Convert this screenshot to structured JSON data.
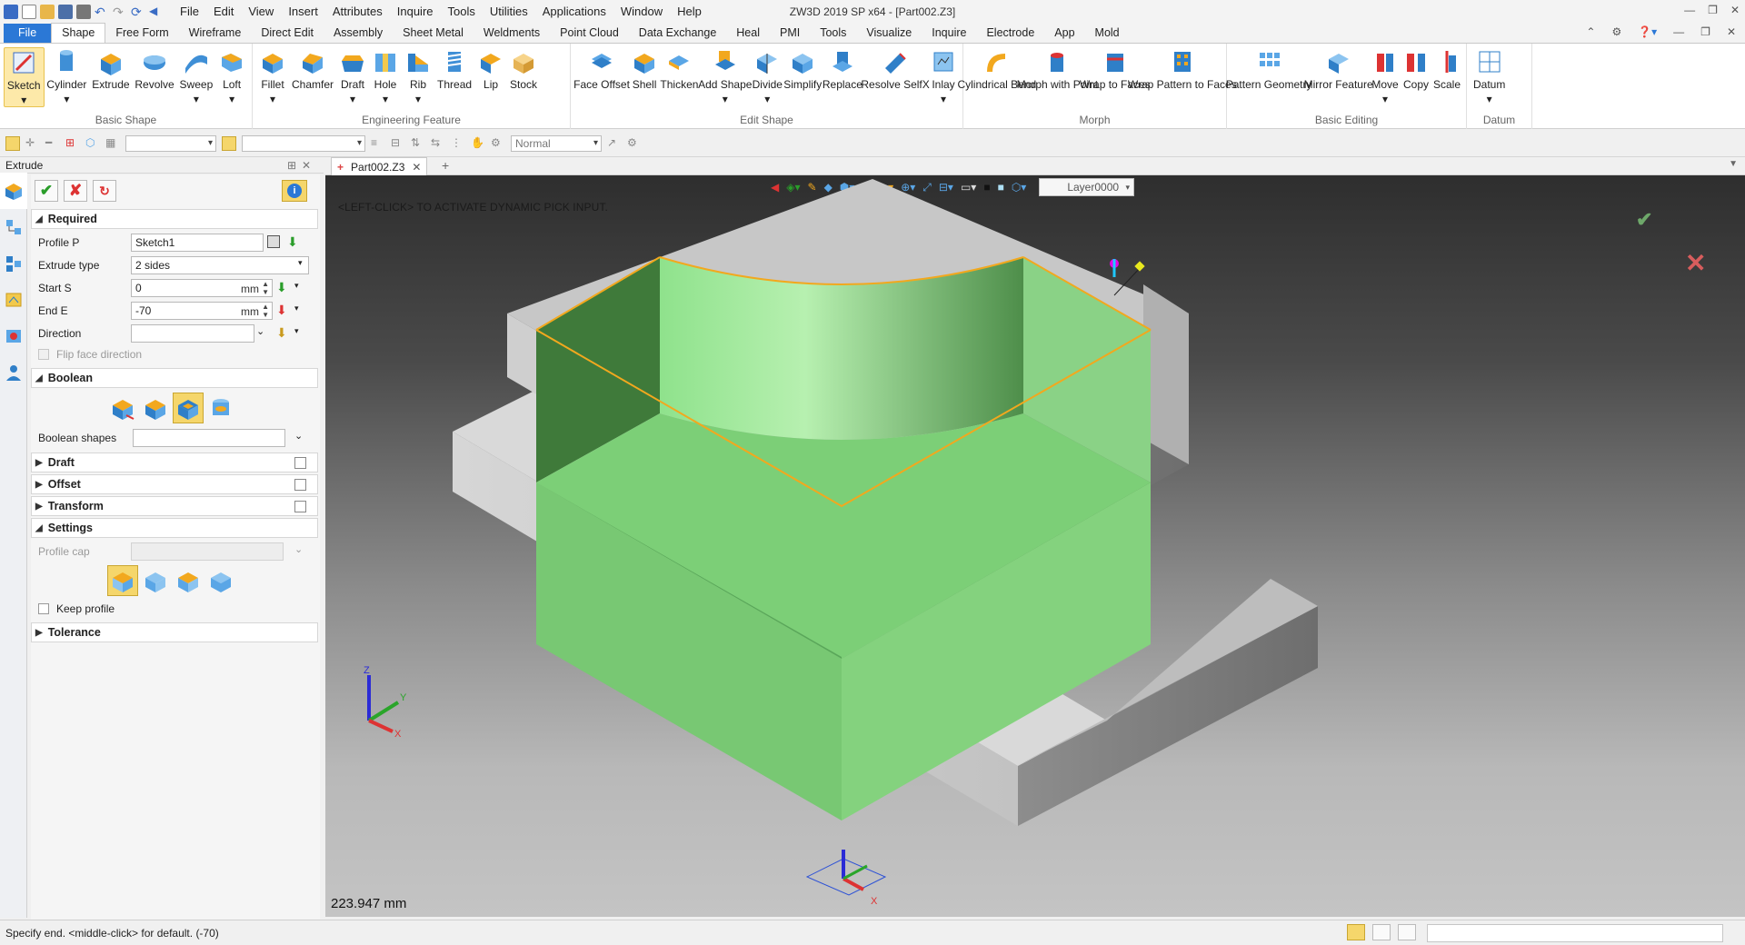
{
  "app": {
    "title": "ZW3D 2019 SP x64 - [Part002.Z3]"
  },
  "menu": [
    "File",
    "Edit",
    "View",
    "Insert",
    "Attributes",
    "Inquire",
    "Tools",
    "Utilities",
    "Applications",
    "Window",
    "Help"
  ],
  "ribbon_tabs": [
    "File",
    "Shape",
    "Free Form",
    "Wireframe",
    "Direct Edit",
    "Assembly",
    "Sheet Metal",
    "Weldments",
    "Point Cloud",
    "Data Exchange",
    "Heal",
    "PMI",
    "Tools",
    "Visualize",
    "Inquire",
    "Electrode",
    "App",
    "Mold"
  ],
  "ribbon": {
    "basic_shape": {
      "name": "Basic Shape",
      "items": [
        "Sketch",
        "Cylinder",
        "Extrude",
        "Revolve",
        "Sweep",
        "Loft"
      ]
    },
    "engineering_feature": {
      "name": "Engineering Feature",
      "items": [
        "Fillet",
        "Chamfer",
        "Draft",
        "Hole",
        "Rib",
        "Thread",
        "Lip",
        "Stock"
      ]
    },
    "edit_shape": {
      "name": "Edit Shape",
      "items": [
        "Face Offset",
        "Shell",
        "Thicken",
        "Add Shape",
        "Divide",
        "Simplify",
        "Replace",
        "Resolve SelfX",
        "Inlay"
      ]
    },
    "morph": {
      "name": "Morph",
      "items": [
        "Cylindrical Bend",
        "Morph with Point",
        "Wrap to Faces",
        "Wrap Pattern to Faces"
      ]
    },
    "basic_editing": {
      "name": "Basic Editing",
      "items": [
        "Pattern Geometry",
        "Mirror Feature",
        "Move",
        "Copy",
        "Scale"
      ]
    },
    "datum": {
      "name": "Datum",
      "items": [
        "Datum"
      ]
    }
  },
  "toolbar2": {
    "render_mode": "Normal"
  },
  "panel": {
    "title": "Extrude",
    "required_label": "Required",
    "profile_label": "Profile P",
    "profile_value": "Sketch1",
    "extrude_type_label": "Extrude type",
    "extrude_type_value": "2 sides",
    "start_label": "Start S",
    "start_value": "0",
    "end_label": "End E",
    "end_value": "-70",
    "unit": "mm",
    "direction_label": "Direction",
    "direction_value": "",
    "flip_label": "Flip face direction",
    "boolean_label": "Boolean",
    "boolean_shapes_label": "Boolean shapes",
    "draft_label": "Draft",
    "offset_label": "Offset",
    "transform_label": "Transform",
    "settings_label": "Settings",
    "profile_cap_label": "Profile cap",
    "keep_profile_label": "Keep profile",
    "tolerance_label": "Tolerance"
  },
  "document": {
    "tab": "Part002.Z3"
  },
  "viewport": {
    "hint": "<LEFT-CLICK> TO ACTIVATE DYNAMIC PICK INPUT.",
    "measure": "223.947 mm",
    "layer": "Layer0000",
    "colors": {
      "model_grey": "#c9c9c9",
      "extrude_green": "#7fd27a",
      "profile_edge": "#f2a81e"
    }
  },
  "status": {
    "message": "Specify end.  <middle-click> for default. (-70)"
  }
}
